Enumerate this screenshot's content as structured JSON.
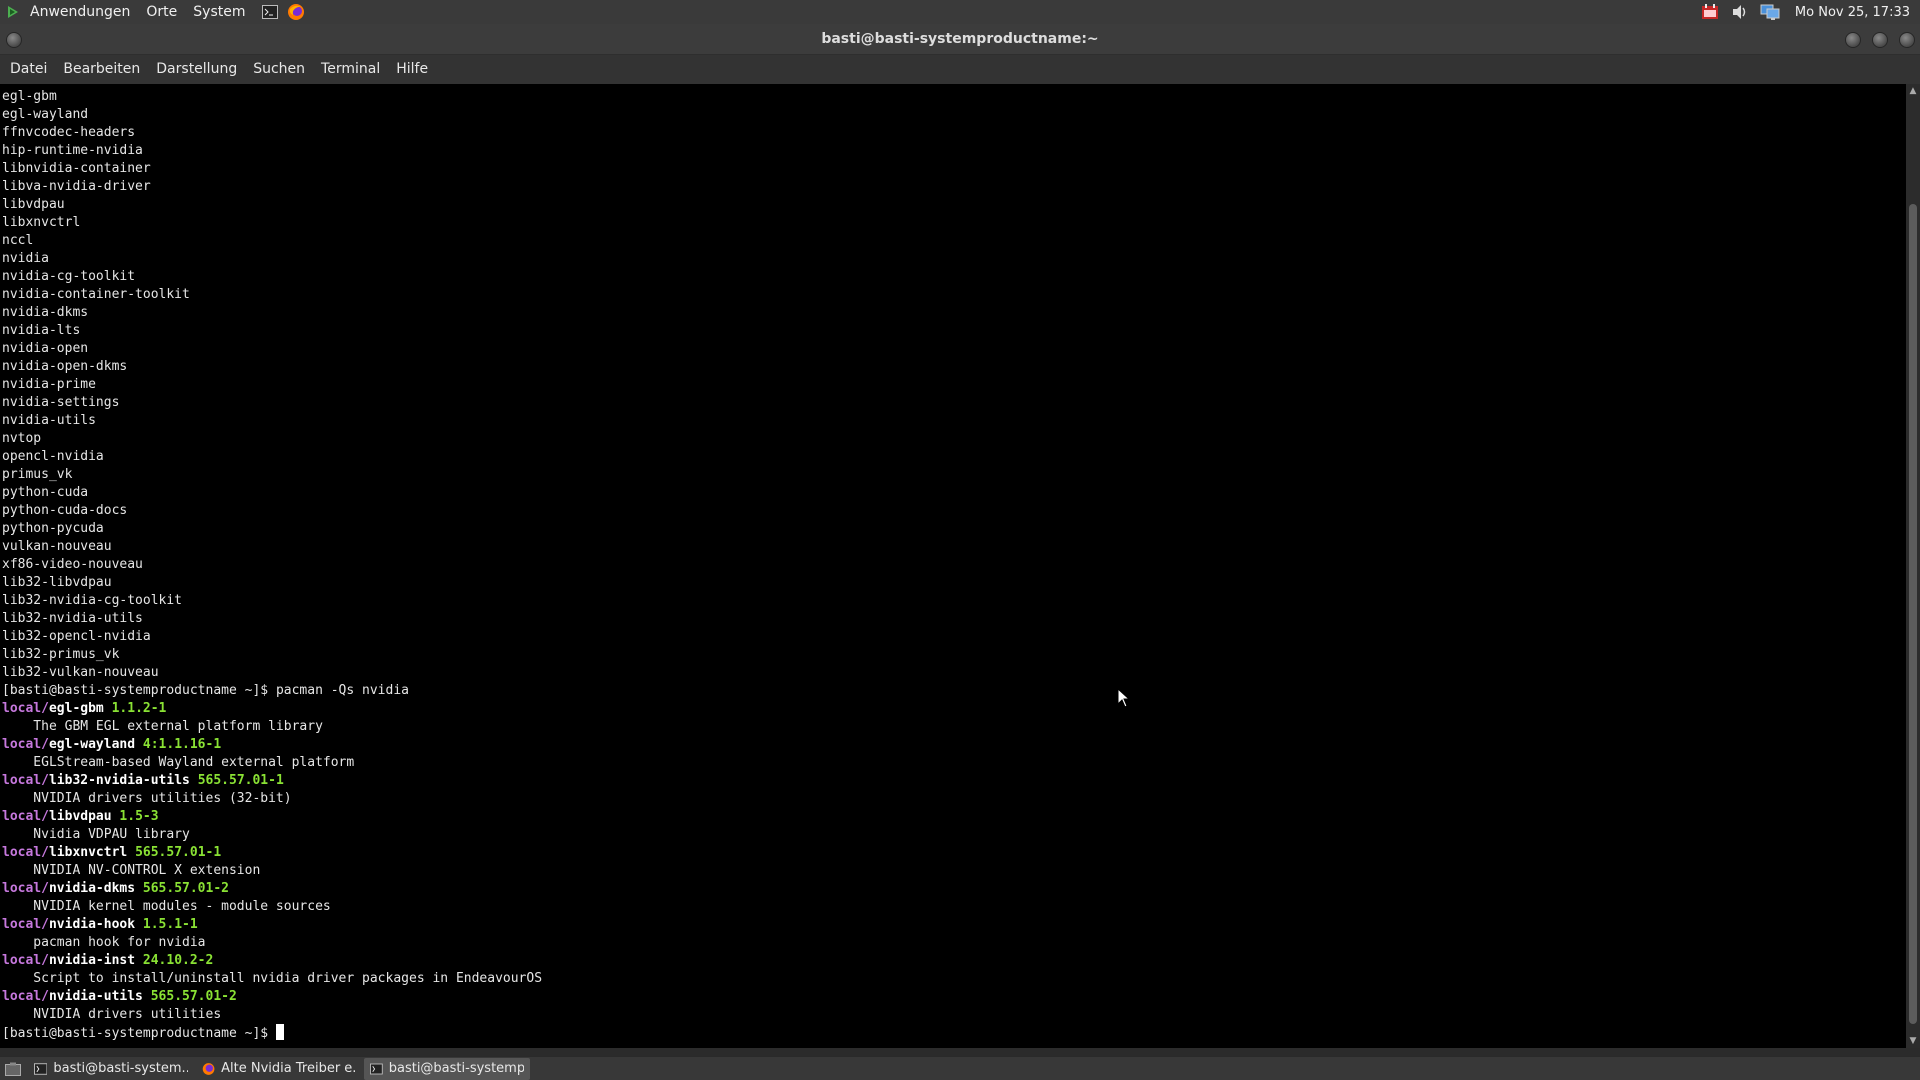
{
  "top_panel": {
    "menus": [
      "Anwendungen",
      "Orte",
      "System"
    ],
    "launchers": [
      "terminal-icon",
      "firefox-icon"
    ],
    "tray_icons": [
      "calendar-icon",
      "volume-icon",
      "network-icon"
    ],
    "clock": "Mo Nov 25, 17:33"
  },
  "window": {
    "title": "basti@basti-systemproductname:~",
    "menu": [
      "Datei",
      "Bearbeiten",
      "Darstellung",
      "Suchen",
      "Terminal",
      "Hilfe"
    ]
  },
  "terminal": {
    "plain_lines": [
      "egl-gbm",
      "egl-wayland",
      "ffnvcodec-headers",
      "hip-runtime-nvidia",
      "libnvidia-container",
      "libva-nvidia-driver",
      "libvdpau",
      "libxnvctrl",
      "nccl",
      "nvidia",
      "nvidia-cg-toolkit",
      "nvidia-container-toolkit",
      "nvidia-dkms",
      "nvidia-lts",
      "nvidia-open",
      "nvidia-open-dkms",
      "nvidia-prime",
      "nvidia-settings",
      "nvidia-utils",
      "nvtop",
      "opencl-nvidia",
      "primus_vk",
      "python-cuda",
      "python-cuda-docs",
      "python-pycuda",
      "vulkan-nouveau",
      "xf86-video-nouveau",
      "lib32-libvdpau",
      "lib32-nvidia-cg-toolkit",
      "lib32-nvidia-utils",
      "lib32-opencl-nvidia",
      "lib32-primus_vk",
      "lib32-vulkan-nouveau"
    ],
    "prompt": "[basti@basti-systemproductname ~]$ ",
    "command": "pacman -Qs nvidia",
    "results": [
      {
        "repo": "local/",
        "name": "egl-gbm",
        "version": "1.1.2-1",
        "desc": "    The GBM EGL external platform library"
      },
      {
        "repo": "local/",
        "name": "egl-wayland",
        "version": "4:1.1.16-1",
        "desc": "    EGLStream-based Wayland external platform"
      },
      {
        "repo": "local/",
        "name": "lib32-nvidia-utils",
        "version": "565.57.01-1",
        "desc": "    NVIDIA drivers utilities (32-bit)"
      },
      {
        "repo": "local/",
        "name": "libvdpau",
        "version": "1.5-3",
        "desc": "    Nvidia VDPAU library"
      },
      {
        "repo": "local/",
        "name": "libxnvctrl",
        "version": "565.57.01-1",
        "desc": "    NVIDIA NV-CONTROL X extension"
      },
      {
        "repo": "local/",
        "name": "nvidia-dkms",
        "version": "565.57.01-2",
        "desc": "    NVIDIA kernel modules - module sources"
      },
      {
        "repo": "local/",
        "name": "nvidia-hook",
        "version": "1.5.1-1",
        "desc": "    pacman hook for nvidia"
      },
      {
        "repo": "local/",
        "name": "nvidia-inst",
        "version": "24.10.2-2",
        "desc": "    Script to install/uninstall nvidia driver packages in EndeavourOS"
      },
      {
        "repo": "local/",
        "name": "nvidia-utils",
        "version": "565.57.01-2",
        "desc": "    NVIDIA drivers utilities"
      }
    ],
    "final_prompt": "[basti@basti-systemproductname ~]$ "
  },
  "taskbar": {
    "tasks": [
      {
        "icon": "terminal-icon",
        "label": "basti@basti-system...",
        "active": false
      },
      {
        "icon": "firefox-icon",
        "label": "Alte Nvidia Treiber e...",
        "active": false
      },
      {
        "icon": "terminal-icon",
        "label": "basti@basti-systemp...",
        "active": true
      }
    ]
  },
  "colors": {
    "repo": "#c678dd",
    "version": "#8ae234",
    "terminal_bg": "#000000",
    "terminal_fg": "#e6e6e6"
  }
}
